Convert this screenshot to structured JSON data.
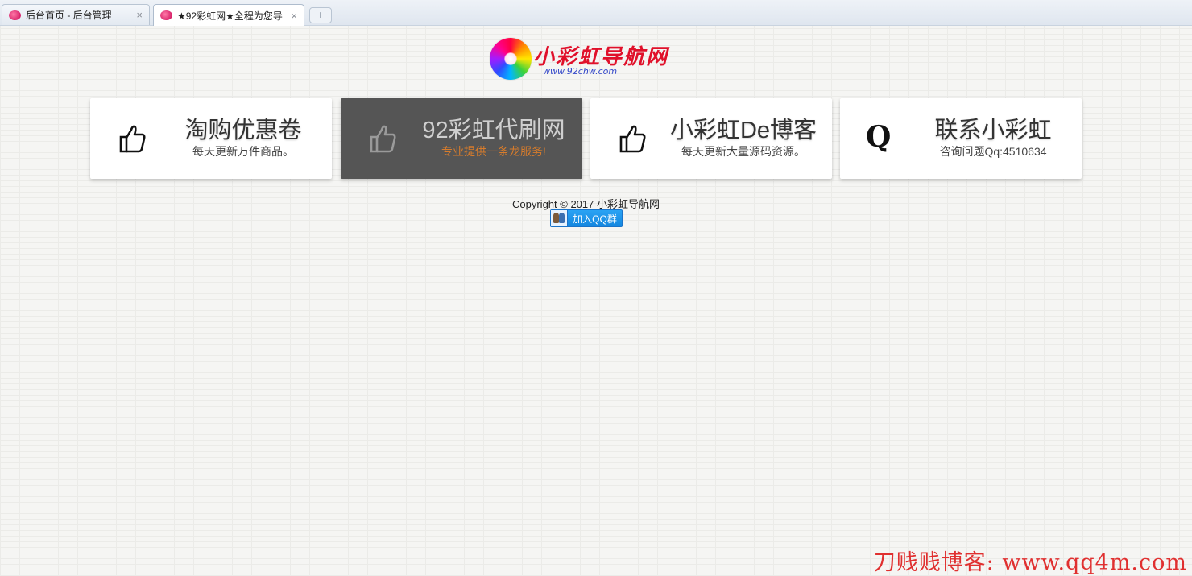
{
  "tabs": [
    {
      "title": "后台首页 - 后台管理",
      "close": "×",
      "active": false
    },
    {
      "title": "★92彩虹网★全程为您导",
      "close": "×",
      "active": true
    }
  ],
  "new_tab_label": "+",
  "logo": {
    "brand": "小彩虹导航网",
    "url": "www.92chw.com"
  },
  "cards": [
    {
      "icon": "thumbs-up-icon",
      "title": "淘购优惠卷",
      "subtitle": "每天更新万件商品。",
      "dark": false
    },
    {
      "icon": "thumbs-up-icon",
      "title": "92彩虹代刷网",
      "subtitle": "专业提供一条龙服务!",
      "dark": true
    },
    {
      "icon": "thumbs-up-icon",
      "title": "小彩虹De博客",
      "subtitle": "每天更新大量源码资源。",
      "dark": false
    },
    {
      "icon": "q-letter-icon",
      "icon_text": "Q",
      "title": "联系小彩虹",
      "subtitle": "咨询问题Qq:4510634",
      "dark": false
    }
  ],
  "footer": {
    "copyright": "Copyright © 2017 小彩虹导航网",
    "qq_button": "加入QQ群"
  },
  "watermark": "刀贱贱博客: www.qq4m.com",
  "colors": {
    "dark_card": "#555555",
    "dark_card_subtitle": "#d77c2c",
    "qq_button": "#1487df",
    "watermark": "#e03030"
  }
}
